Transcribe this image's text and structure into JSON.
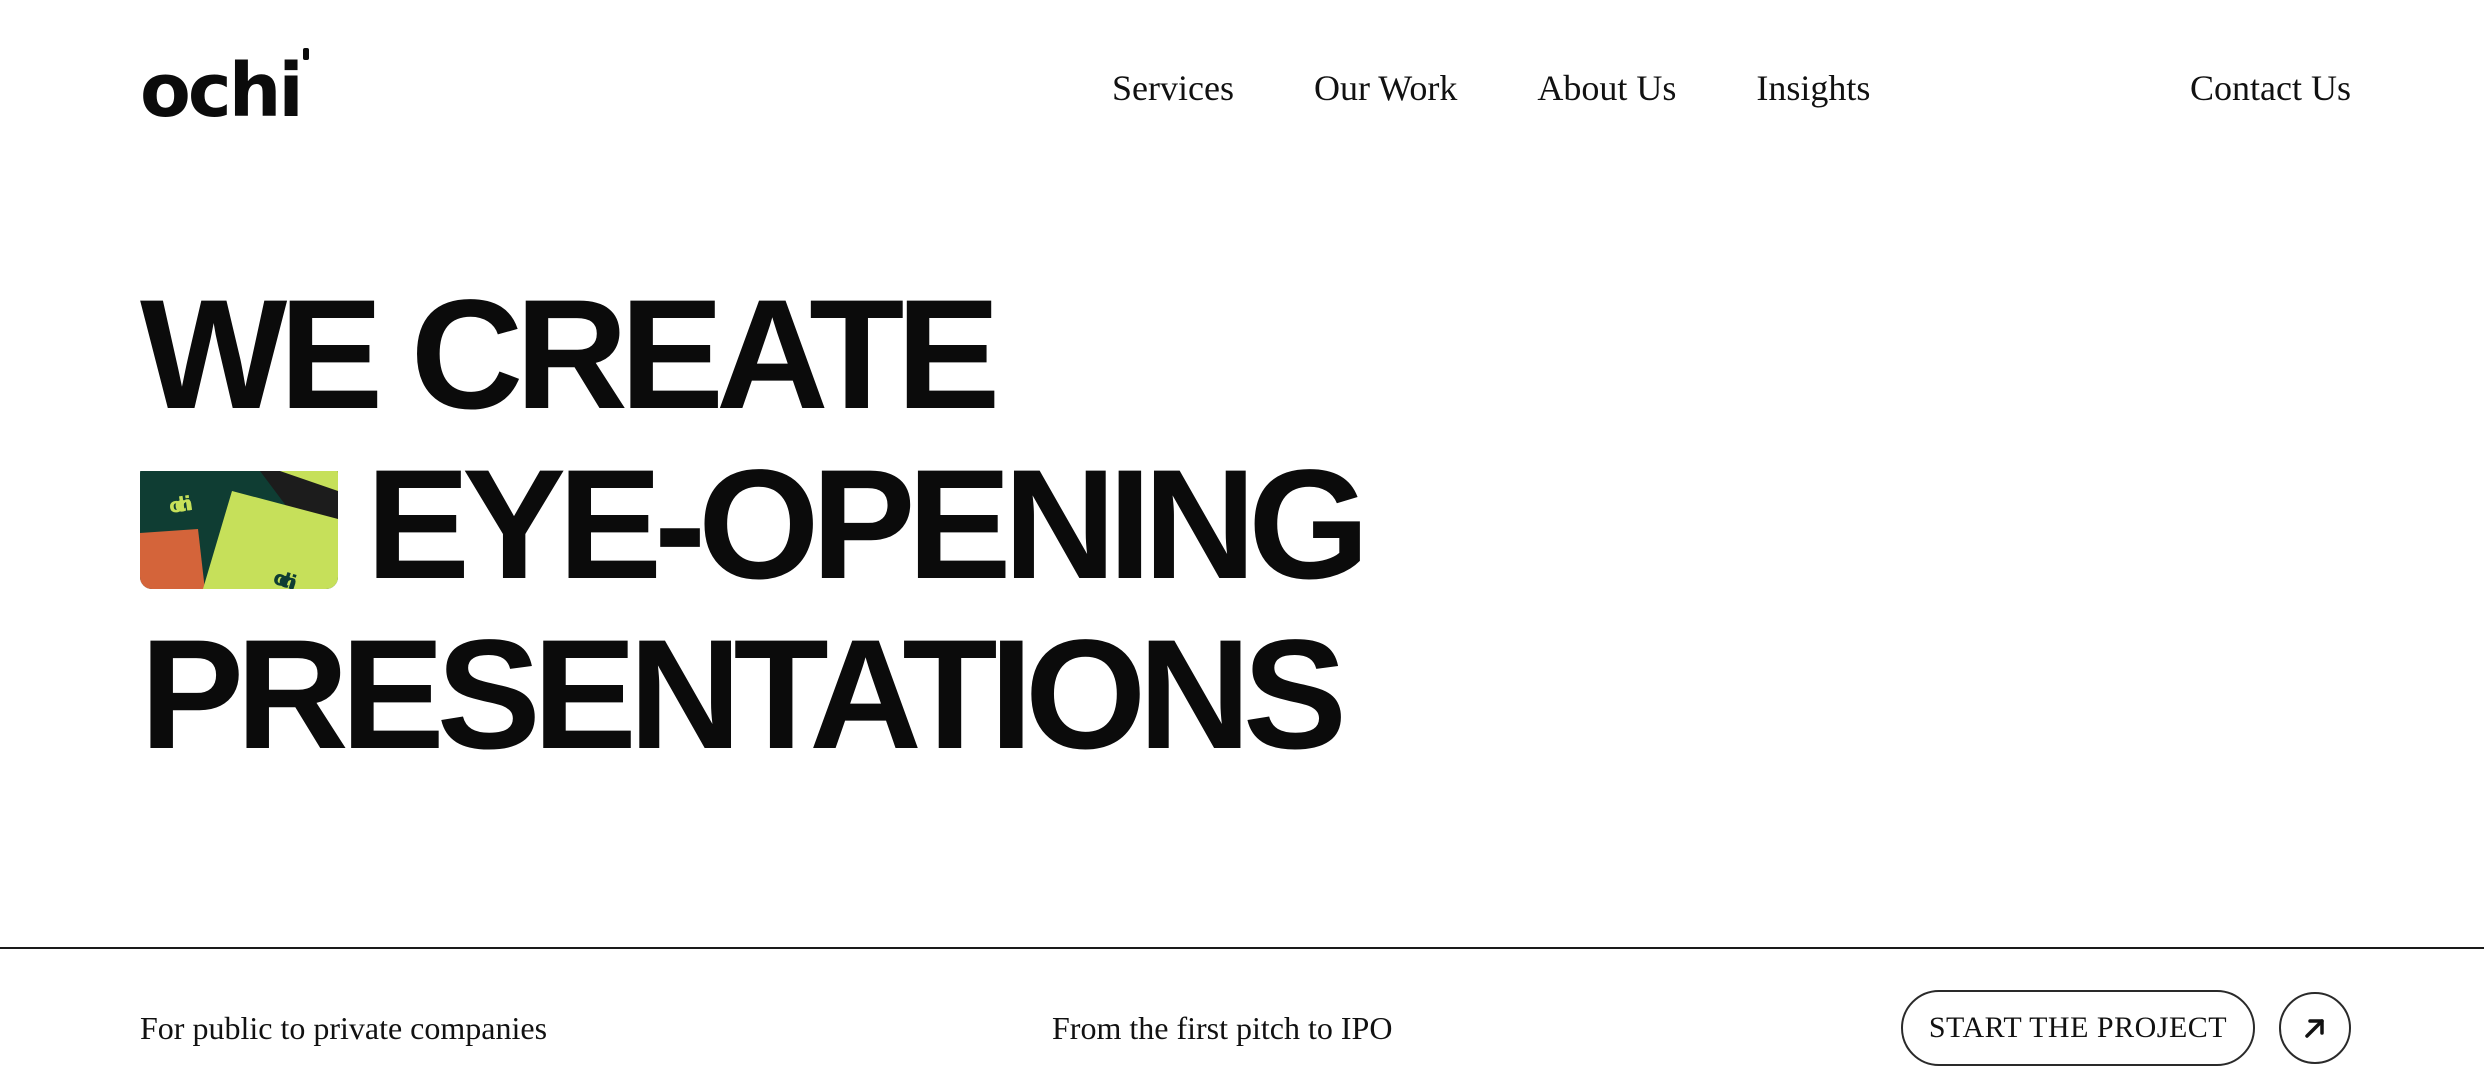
{
  "header": {
    "logo_text": "ochi",
    "nav": [
      {
        "label": "Services"
      },
      {
        "label": "Our Work"
      },
      {
        "label": "About Us"
      },
      {
        "label": "Insights"
      }
    ],
    "contact_label": "Contact Us"
  },
  "hero": {
    "line1": "WE CREATE",
    "line2": "EYE-OPENING",
    "line3": "PRESENTATIONS",
    "thumb_texts": [
      "ochi",
      "ochi"
    ],
    "colors": {
      "thumb_dark_green": "#0f3d33",
      "thumb_lime": "#c6e05a",
      "thumb_orange": "#d4643a",
      "thumb_black": "#1c1c1c"
    }
  },
  "footer": {
    "left_text": "For public to private companies",
    "middle_text": "From the first pitch to IPO",
    "cta_label": "START THE PROJECT",
    "cta_icon": "arrow-up-right-icon"
  }
}
